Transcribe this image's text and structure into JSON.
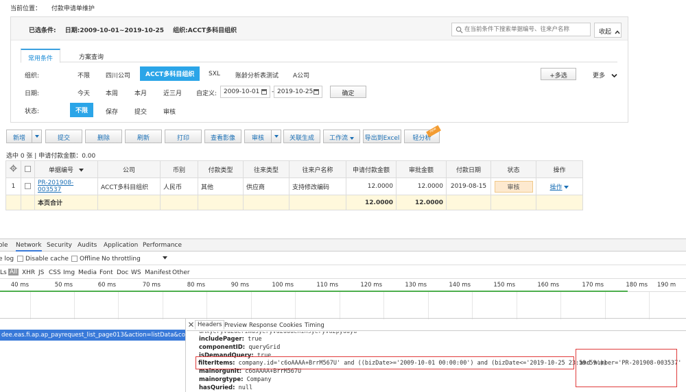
{
  "breadcrumb": {
    "label": "当前位置：",
    "page": "付款申请单维护"
  },
  "filter": {
    "chosen": {
      "label": "已选条件:",
      "date": "日期:2009-10-01~2019-10-25",
      "org": "组织:ACCT多科目组织"
    },
    "search_placeholder": "在当前条件下搜索单据编号、往来户名称",
    "collapse_label": "收起",
    "tabs": [
      "常用条件",
      "方案查询"
    ],
    "org": {
      "label": "组织:",
      "options": [
        "不限",
        "四川公司",
        "ACCT多科目组织",
        "SXL",
        "账龄分析表测试",
        "A公司"
      ]
    },
    "date": {
      "label": "日期:",
      "options": [
        "今天",
        "本周",
        "本月",
        "近三月"
      ],
      "custom_label": "自定义:",
      "from": "2009-10-01",
      "to": "2019-10-25",
      "ok": "确定"
    },
    "status": {
      "label": "状态:",
      "options": [
        "不限",
        "保存",
        "提交",
        "审核"
      ]
    },
    "multi": "+多选",
    "more": "更多"
  },
  "toolbar": {
    "new": "新增",
    "submit": "提交",
    "delete": "删除",
    "refresh": "刷新",
    "print": "打印",
    "view_image": "查看影像",
    "audit": "审核",
    "gen": "关联生成",
    "workflow": "工作流",
    "export": "导出到Excel",
    "analysis": "轻分析",
    "badge": "new"
  },
  "selection_info": "选中 0 张 | 申请付款金额：0.00",
  "table": {
    "headers": [
      "单据编号",
      "公司",
      "币别",
      "付款类型",
      "往来类型",
      "往来户名称",
      "申请付款金额",
      "审批金额",
      "付款日期",
      "状态",
      "操作"
    ],
    "rows": [
      {
        "idx": "1",
        "number": "PR-201908-003537",
        "company": "ACCT多科目组织",
        "currency": "人民币",
        "pay_type": "其他",
        "partner_type": "供应商",
        "partner": "支持修改编码",
        "apply_amt": "12.0000",
        "approve_amt": "12.0000",
        "pay_date": "2019-08-15",
        "status": "审核",
        "action": "操作"
      }
    ],
    "sum": {
      "label": "本页合计",
      "apply_amt": "12.0000",
      "approve_amt": "12.0000"
    }
  },
  "devtools": {
    "tabs": [
      "ole",
      "Network",
      "Security",
      "Audits",
      "Application",
      "Performance"
    ],
    "options": [
      "e log",
      "Disable cache",
      "Offline",
      "No throttling"
    ],
    "filters": [
      "Ls",
      "All",
      "XHR",
      "JS",
      "CSS",
      "Img",
      "Media",
      "Font",
      "Doc",
      "WS",
      "Manifest",
      "Other"
    ],
    "ticks": [
      "40 ms",
      "50 ms",
      "60 ms",
      "70 ms",
      "80 ms",
      "90 ms",
      "100 ms",
      "110 ms",
      "120 ms",
      "130 ms",
      "140 ms",
      "150 ms",
      "160 ms",
      "170 ms",
      "180 ms",
      "190 m"
    ],
    "request": "dee.eas.fi.ap.ap_payrequest_list_page013&action=listData&conversati...",
    "detail_tabs": [
      "Headers",
      "Preview",
      "Response",
      "Cookies",
      "Timing"
    ],
    "params": {
      "top_cut": "uMxyeryvu2uerimusyeryvu2uuueninsyeryvu2pyuuyu",
      "includePager": "true",
      "componentID": "queryGrid",
      "isDemandQuery": "true",
      "filterItems_key": "filterItems:",
      "filterItems": "company.id='c6oAAAA+BrrM567U'  and ((bizDate>='2009-10-01 00:00:00') and (bizDate<='2019-10-25 23:59:59'))",
      "filterItems_tail": "and number='PR-201908-003537'",
      "mainorgunit": "c6oAAAA+BrrM567U",
      "mainorgtype": "Company",
      "hasQuried": "null"
    }
  }
}
